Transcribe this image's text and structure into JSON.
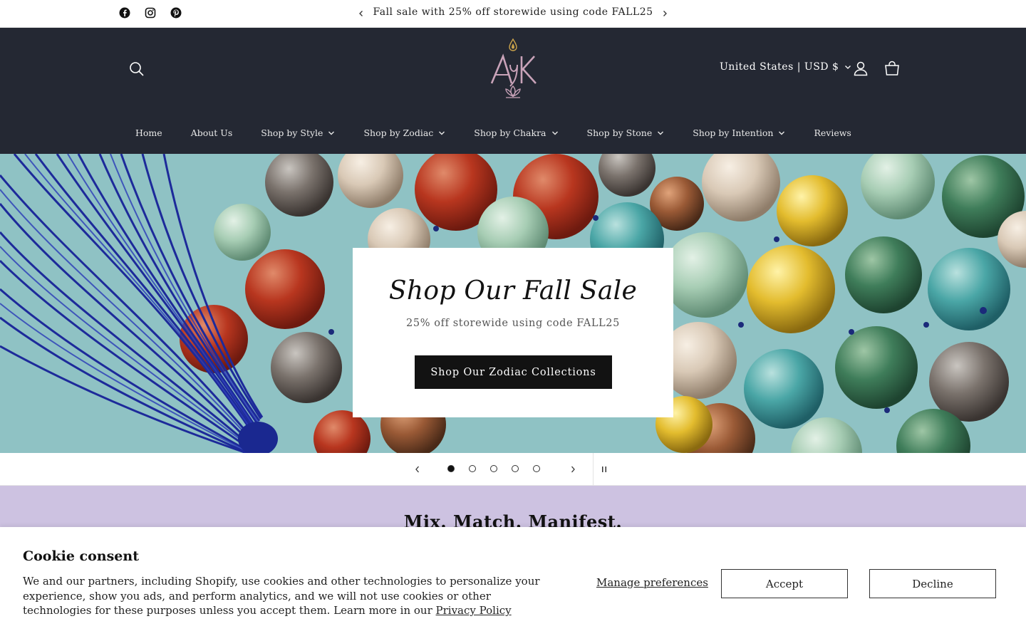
{
  "announcement": {
    "text": "Fall sale with 25% off storewide using code FALL25",
    "social_icons": [
      "facebook-icon",
      "instagram-icon",
      "pinterest-icon"
    ]
  },
  "header": {
    "logo_text": "AK",
    "currency": "United States | USD $",
    "nav": [
      {
        "label": "Home",
        "has_dropdown": false
      },
      {
        "label": "About Us",
        "has_dropdown": false
      },
      {
        "label": "Shop by Style",
        "has_dropdown": true
      },
      {
        "label": "Shop by Zodiac",
        "has_dropdown": true
      },
      {
        "label": "Shop by Chakra",
        "has_dropdown": true
      },
      {
        "label": "Shop by Stone",
        "has_dropdown": true
      },
      {
        "label": "Shop by Intention",
        "has_dropdown": true
      },
      {
        "label": "Reviews",
        "has_dropdown": false
      }
    ]
  },
  "hero": {
    "title": "Shop Our Fall Sale",
    "subtitle": "25% off storewide using code FALL25",
    "button_label": "Shop Our Zodiac Collections",
    "slide_count": 5,
    "active_slide": 1
  },
  "section": {
    "title": "Mix. Match. Manifest."
  },
  "cookie": {
    "title": "Cookie consent",
    "text": "We and our partners, including Shopify, use cookies and other technologies to personalize your experience, show you ads, and perform analytics, and we will not use cookies or other technologies for these purposes unless you accept them. Learn more in our ",
    "link": "Privacy Policy",
    "manage": "Manage preferences",
    "accept": "Accept",
    "decline": "Decline"
  },
  "colors": {
    "header_bg": "#242833",
    "band_purple": "#cdc2e1",
    "logo_pink": "#c9a3b9",
    "logo_gold": "#c9a24a"
  }
}
